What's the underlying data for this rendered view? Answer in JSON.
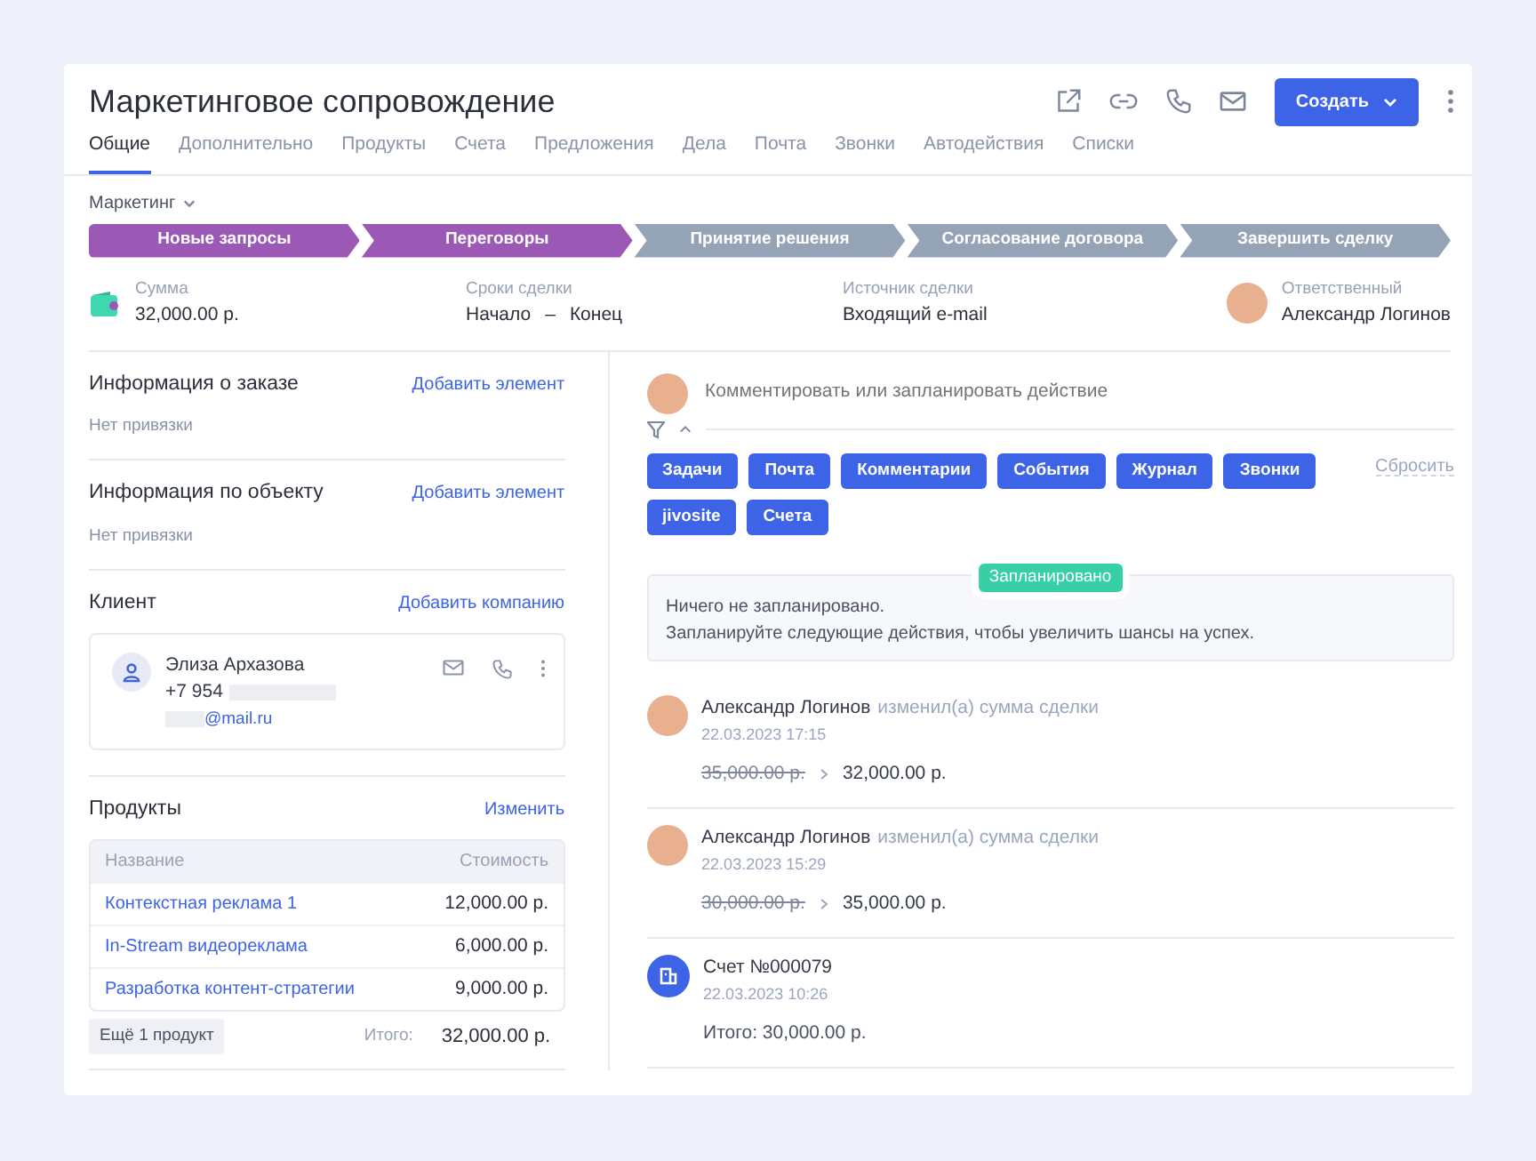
{
  "header": {
    "title": "Маркетинговое сопровождение",
    "create_button": "Создать"
  },
  "tabs": [
    {
      "label": "Общие",
      "selected": true
    },
    {
      "label": "Дополнительно",
      "selected": false
    },
    {
      "label": "Продукты",
      "selected": false
    },
    {
      "label": "Счета",
      "selected": false
    },
    {
      "label": "Предложения",
      "selected": false
    },
    {
      "label": "Дела",
      "selected": false
    },
    {
      "label": "Почта",
      "selected": false
    },
    {
      "label": "Звонки",
      "selected": false
    },
    {
      "label": "Автодействия",
      "selected": false
    },
    {
      "label": "Списки",
      "selected": false
    }
  ],
  "pipeline": {
    "name": "Маркетинг",
    "stages": [
      {
        "label": "Новые запросы",
        "done": true
      },
      {
        "label": "Переговоры",
        "done": true
      },
      {
        "label": "Принятие решения",
        "done": false
      },
      {
        "label": "Согласование договора",
        "done": false
      },
      {
        "label": "Завершить сделку",
        "done": false
      }
    ]
  },
  "summary": [
    {
      "kind": "amount",
      "label": "Сумма",
      "value": "32,000.00 р."
    },
    {
      "kind": "period",
      "label": "Сроки сделки",
      "start": "Начало",
      "separator": "–",
      "end": "Конец"
    },
    {
      "kind": "plain",
      "label": "Источник сделки",
      "value": "Входящий e-mail"
    },
    {
      "kind": "person",
      "label": "Ответственный",
      "value": "Александр Логинов"
    }
  ],
  "sections": [
    {
      "title": "Информация о заказе",
      "action": "Добавить элемент",
      "empty": "Нет привязки"
    },
    {
      "title": "Информация по объекту",
      "action": "Добавить элемент",
      "empty": "Нет привязки"
    }
  ],
  "client": {
    "title": "Клиент",
    "action": "Добавить компанию",
    "name": "Элиза Архазова",
    "phone": "+7 954",
    "email": "@mail.ru"
  },
  "products": {
    "title": "Продукты",
    "action": "Изменить",
    "columns": [
      "Название",
      "Стоимость"
    ],
    "rows": [
      {
        "name": "Контекстная реклама 1",
        "price": "12,000.00 р."
      },
      {
        "name": "In-Stream видеореклама",
        "price": "6,000.00 р."
      },
      {
        "name": "Разработка контент-стратегии",
        "price": "9,000.00 р."
      }
    ],
    "more": "Ещё 1 продукт",
    "total_label": "Итого:",
    "total": "32,000.00 р."
  },
  "composer": {
    "placeholder": "Комментировать или запланировать действие"
  },
  "filters": [
    {
      "label": "Задачи",
      "selected": true
    },
    {
      "label": "Почта",
      "selected": true
    },
    {
      "label": "Комментарии",
      "selected": true
    },
    {
      "label": "События",
      "selected": true
    },
    {
      "label": "Журнал",
      "selected": true
    },
    {
      "label": "Звонки",
      "selected": true
    },
    {
      "label": "jivosite",
      "selected": true
    },
    {
      "label": "Счета",
      "selected": true
    }
  ],
  "reset": "Сбросить",
  "planned": {
    "badge": "Запланировано",
    "lines": [
      "Ничего не запланировано.",
      "Запланируйте следующие действия, чтобы увеличить шансы на успех."
    ]
  },
  "timeline": [
    {
      "kind": "change",
      "author": "Александр Логинов",
      "action": "изменил(а) сумма сделки",
      "time": "22.03.2023 17:15",
      "old": "35,000.00 р.",
      "new": "32,000.00 р."
    },
    {
      "kind": "change",
      "author": "Александр Логинов",
      "action": "изменил(а) сумма сделки",
      "time": "22.03.2023 15:29",
      "old": "30,000.00 р.",
      "new": "35,000.00 р."
    },
    {
      "kind": "invoice",
      "title": "Счет №000079",
      "time": "22.03.2023 10:26",
      "detail": "Итого: 30,000.00 р."
    }
  ]
}
